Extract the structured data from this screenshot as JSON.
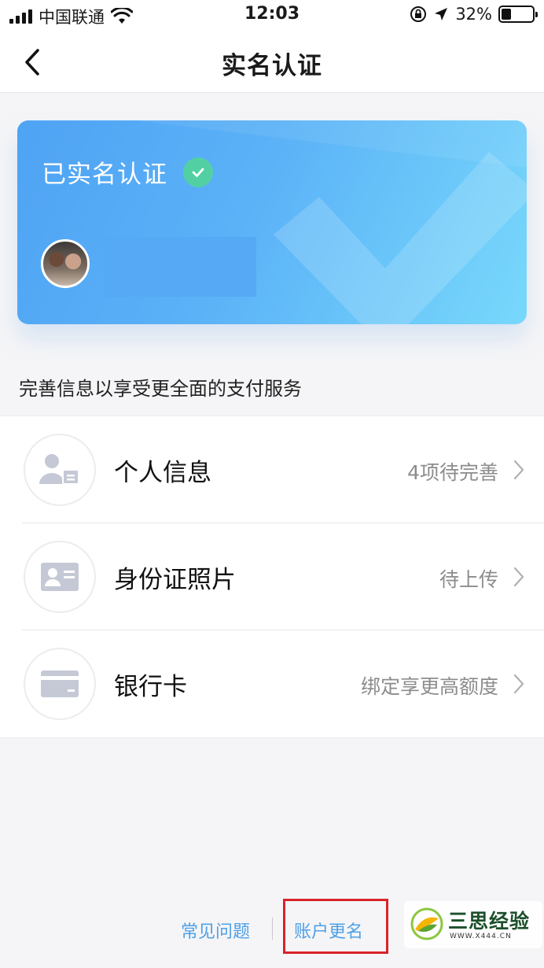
{
  "status_bar": {
    "carrier": "中国联通",
    "time": "12:03",
    "battery_percent": "32%",
    "battery_level": 0.32,
    "icons": [
      "signal-icon",
      "wifi-icon",
      "rotation-lock-icon",
      "location-arrow-icon",
      "battery-icon"
    ]
  },
  "nav": {
    "title": "实名认证",
    "back_icon": "chevron-left-icon"
  },
  "card": {
    "status_text": "已实名认证",
    "status_icon": "check-circle-icon",
    "accent_colors": [
      "#4fa3f4",
      "#78d8fb"
    ],
    "badge_color": "#52d0a4"
  },
  "promo_text": "完善信息以享受更全面的支付服务",
  "items": [
    {
      "label": "个人信息",
      "status": "4项待完善",
      "icon": "person-info-icon"
    },
    {
      "label": "身份证照片",
      "status": "待上传",
      "icon": "id-card-icon"
    },
    {
      "label": "银行卡",
      "status": "绑定享更高额度",
      "icon": "bank-card-icon"
    }
  ],
  "footer": {
    "faq": "常见问题",
    "rename": "账户更名",
    "link_color": "#4ea0e6"
  },
  "watermark": {
    "name": "三思经验",
    "url": "WWW.X444.CN"
  }
}
